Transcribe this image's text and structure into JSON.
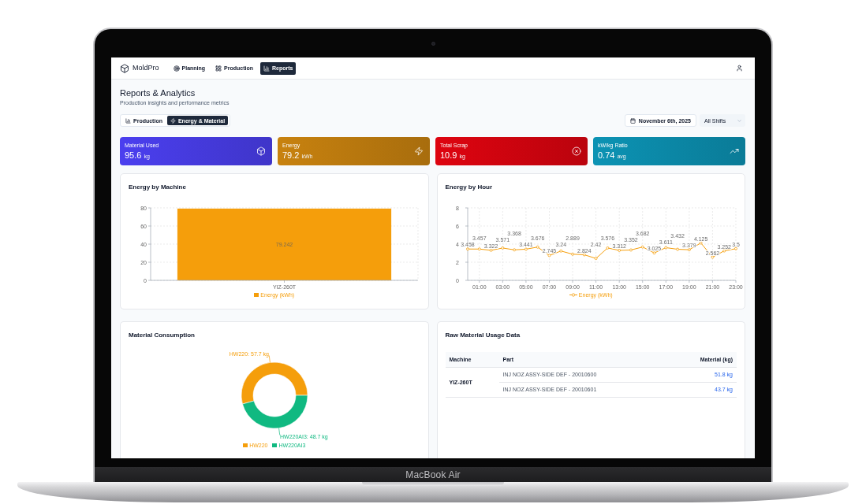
{
  "nav": {
    "brand": "MoldPro",
    "items": [
      {
        "label": "Planning",
        "selected": false
      },
      {
        "label": "Production",
        "selected": false
      },
      {
        "label": "Reports",
        "selected": true
      }
    ]
  },
  "header": {
    "title": "Reports & Analytics",
    "subtitle": "Production insights and performance metrics"
  },
  "tabs": [
    {
      "label": "Production",
      "selected": false
    },
    {
      "label": "Energy & Material",
      "selected": true
    }
  ],
  "filters": {
    "date": "November 6th, 2025",
    "shift": "All Shifts"
  },
  "kpis": [
    {
      "label": "Material Used",
      "value": "95.6",
      "unit": "kg",
      "color": "#4b3fef"
    },
    {
      "label": "Energy",
      "value": "79.2",
      "unit": "kWh",
      "color": "#c8820f"
    },
    {
      "label": "Total Scrap",
      "value": "10.9",
      "unit": "kg",
      "color": "#de0410"
    },
    {
      "label": "kW/kg Ratio",
      "value": "0.74",
      "unit": "avg",
      "color": "#0c93b4"
    }
  ],
  "energy_by_machine": {
    "title": "Energy by Machine",
    "chart_data": {
      "type": "bar",
      "categories": [
        "YIZ-260T"
      ],
      "series": [
        {
          "name": "Energy (kWh)",
          "color": "#f59e0b",
          "values": [
            79.242
          ]
        }
      ],
      "ylim": [
        0,
        80
      ],
      "yticks": [
        0,
        20,
        40,
        60,
        80
      ],
      "grid": true,
      "legend": "bottom",
      "data_labels": true
    }
  },
  "energy_by_hour": {
    "title": "Energy by Hour",
    "chart_data": {
      "type": "line",
      "x": [
        0,
        1,
        2,
        3,
        4,
        5,
        6,
        7,
        8,
        9,
        10,
        11,
        12,
        13,
        14,
        15,
        16,
        17,
        18,
        19,
        20,
        21,
        22,
        23
      ],
      "series": [
        {
          "name": "Energy (kWh)",
          "color": "#f59e0b",
          "marker": "circle",
          "values": [
            3.458,
            3.457,
            3.322,
            3.571,
            3.368,
            3.441,
            3.676,
            2.745,
            3.24,
            2.889,
            2.824,
            2.42,
            3.576,
            3.312,
            3.352,
            3.682,
            3.025,
            3.611,
            3.432,
            3.379,
            4.125,
            2.562,
            3.252,
            3.5
          ]
        }
      ],
      "xlim": [
        0,
        23
      ],
      "ylim": [
        0,
        8
      ],
      "xticks": [
        {
          "value": 1,
          "label": "01:00"
        },
        {
          "value": 3,
          "label": "03:00"
        },
        {
          "value": 5,
          "label": "05:00"
        },
        {
          "value": 7,
          "label": "07:00"
        },
        {
          "value": 9,
          "label": "09:00"
        },
        {
          "value": 11,
          "label": "11:00"
        },
        {
          "value": 13,
          "label": "13:00"
        },
        {
          "value": 15,
          "label": "15:00"
        },
        {
          "value": 17,
          "label": "17:00"
        },
        {
          "value": 19,
          "label": "19:00"
        },
        {
          "value": 21,
          "label": "21:00"
        },
        {
          "value": 23,
          "label": "23:00"
        }
      ],
      "yticks": [
        0,
        2,
        4,
        6,
        8
      ],
      "grid": true,
      "legend": "bottom",
      "data_labels": true
    }
  },
  "material_consumption": {
    "title": "Material Consumption",
    "chart_data": {
      "type": "donut",
      "categories": [
        "HW220",
        "HW220AI3"
      ],
      "values": [
        57.7,
        48.7
      ],
      "colors": [
        "#f59e0b",
        "#10b981"
      ],
      "legend": "bottom",
      "value_labels": [
        "HW220: 57.7 kg",
        "HW220AI3: 48.7 kg"
      ]
    }
  },
  "raw_material_usage": {
    "title": "Raw Material Usage Data",
    "columns": [
      "Machine",
      "Part",
      "Material (kg)"
    ],
    "groups": [
      {
        "machine": "YIZ-260T",
        "rows": [
          {
            "part": "INJ NOZ ASSY-SIDE DEF - 20010600",
            "material": "51.8 kg"
          },
          {
            "part": "INJ NOZ ASSY-SIDE DEF - 20010601",
            "material": "43.7 kg"
          }
        ]
      }
    ]
  },
  "device": {
    "label": "MacBook Air"
  }
}
